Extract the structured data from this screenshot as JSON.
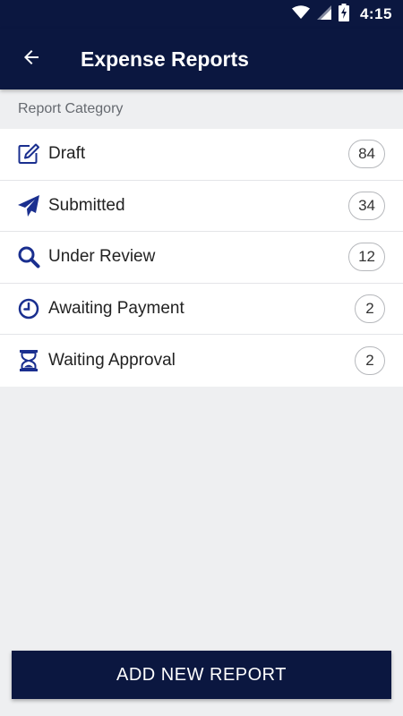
{
  "status_bar": {
    "time": "4:15",
    "icons": [
      "wifi-icon",
      "cell-signal-icon",
      "battery-charging-icon"
    ]
  },
  "app_bar": {
    "title": "Expense Reports",
    "back_icon": "arrow-left-icon"
  },
  "section": {
    "header": "Report Category"
  },
  "categories": [
    {
      "label": "Draft",
      "count": "84",
      "icon": "edit-icon"
    },
    {
      "label": "Submitted",
      "count": "34",
      "icon": "paper-plane-icon"
    },
    {
      "label": "Under Review",
      "count": "12",
      "icon": "search-icon"
    },
    {
      "label": "Awaiting Payment",
      "count": "2",
      "icon": "clock-icon"
    },
    {
      "label": "Waiting Approval",
      "count": "2",
      "icon": "hourglass-icon"
    }
  ],
  "footer": {
    "add_button_label": "ADD NEW REPORT"
  },
  "colors": {
    "primary": "#0b1740",
    "icon_accent": "#1a2f8f",
    "background": "#eeeff1"
  }
}
